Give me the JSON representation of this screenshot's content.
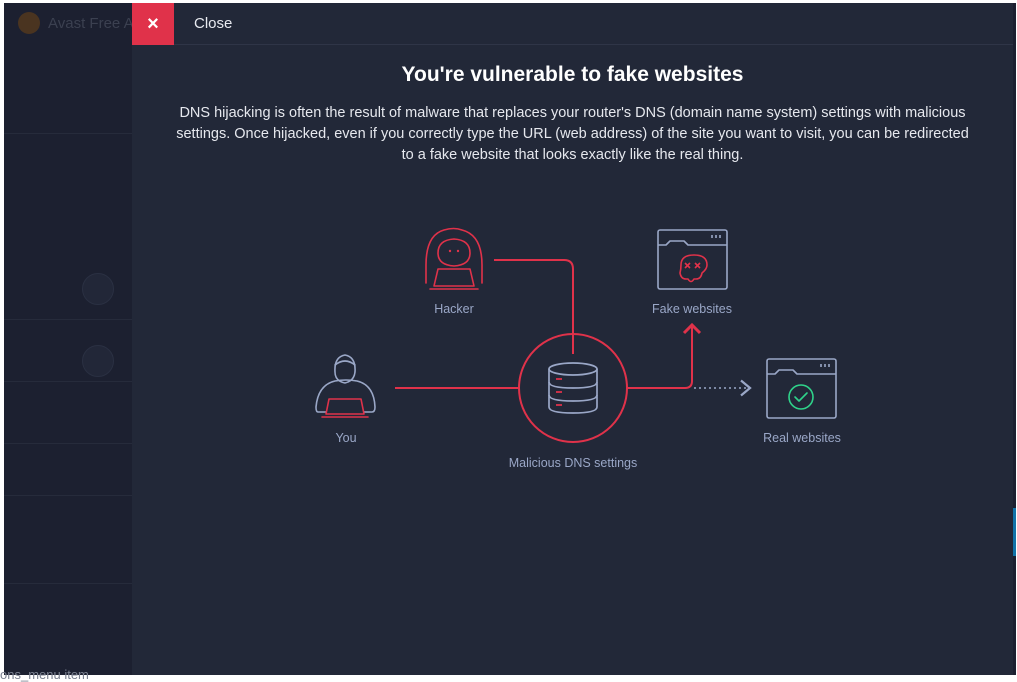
{
  "background_app": {
    "title": "Avast Free A",
    "bottom_fragment": "ons_menu item"
  },
  "overlay": {
    "close_label": "Close",
    "close_icon": "×",
    "title": "You're vulnerable to fake websites",
    "description": "DNS hijacking is often the result of malware that replaces your router's DNS (domain name system) settings with malicious settings. Once hijacked, even if you correctly type the URL (web address) of the site you want to visit, you can be redirected to a fake website that looks exactly like the real thing."
  },
  "diagram": {
    "labels": {
      "hacker": "Hacker",
      "you": "You",
      "dns": "Malicious DNS settings",
      "fake": "Fake websites",
      "real": "Real websites"
    },
    "icons": {
      "hacker": "hooded-hacker-laptop-icon",
      "you": "user-laptop-icon",
      "dns": "database-server-icon",
      "fake": "browser-skull-icon",
      "real": "browser-checkmark-icon"
    }
  },
  "colors": {
    "overlay_bg": "#222838",
    "accent_red": "#e0324a",
    "line_red": "#e0324a",
    "icon_blue": "#9aa7c7",
    "check_green": "#2fd38a",
    "text_white": "#ffffff"
  }
}
